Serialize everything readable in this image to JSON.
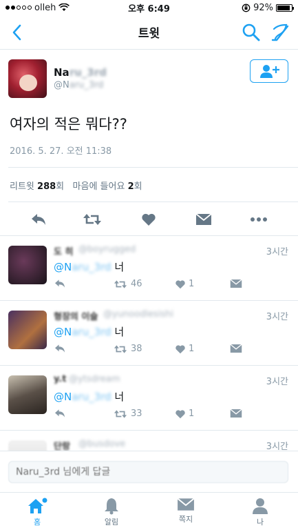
{
  "status_bar": {
    "carrier": "olleh",
    "time": "오후 6:49",
    "battery": "92%",
    "battery_level": 0.92
  },
  "nav": {
    "title": "트윗"
  },
  "tweet": {
    "name_visible": "Na",
    "name_blurred": "ru_3rd",
    "handle_visible": "@N",
    "handle_blurred": "aru_3rd",
    "text": "여자의 적은 뭐다??",
    "date": "2016. 5. 27. 오전 11:38",
    "retweet_label": "리트윗",
    "retweet_count": "288",
    "count_suffix": "회",
    "like_label": "마음에 들어요",
    "like_count": "2",
    "like_suffix": "회"
  },
  "replies": [
    {
      "name": "도 히",
      "handle": "@boyrugged",
      "time": "3시간",
      "mention_visible": "@N",
      "mention_blurred": "aru_3rd",
      "text": " 너",
      "retweets": "46",
      "likes": "1",
      "avatar_colors": [
        "#3a2a3a",
        "#6a3a5a"
      ]
    },
    {
      "name": "형장의 이슬",
      "handle": "@yunoodlesishi",
      "time": "3시간",
      "mention_visible": "@N",
      "mention_blurred": "aru_3rd",
      "text": " 너",
      "retweets": "38",
      "likes": "1",
      "avatar_colors": [
        "#4a3060",
        "#b07040"
      ]
    },
    {
      "name": "y.t",
      "handle": "@ytsdream",
      "time": "3시간",
      "mention_visible": "@N",
      "mention_blurred": "aru_3rd",
      "text": " 너",
      "retweets": "33",
      "likes": "1",
      "avatar_colors": [
        "#5a5048",
        "#c8c0b0"
      ]
    },
    {
      "name": "단랑",
      "handle": "@busdove",
      "time": "3시간"
    }
  ],
  "compose": {
    "placeholder": "Naru_3rd 님에게 답글"
  },
  "tabs": [
    {
      "label": "홈"
    },
    {
      "label": "알림"
    },
    {
      "label": "쪽지"
    },
    {
      "label": "나"
    }
  ],
  "colors": {
    "accent": "#1da1f2",
    "muted": "#8899a6"
  }
}
